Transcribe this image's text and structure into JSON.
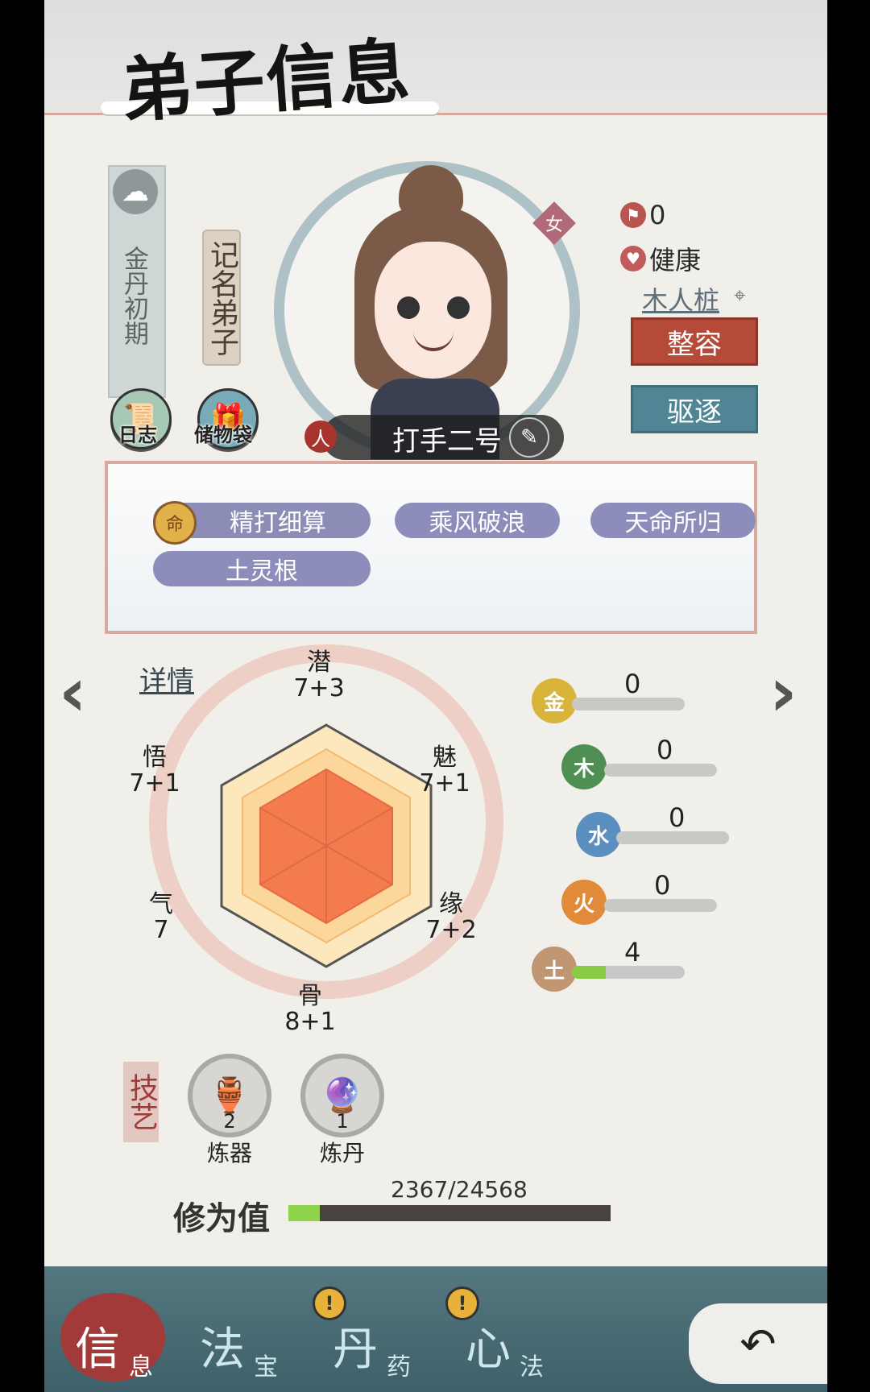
{
  "header": {
    "title": "弟子信息"
  },
  "rank": {
    "realm": "金丹初期",
    "title": "记名弟子"
  },
  "quick_icons": {
    "log_label": "日志",
    "bag_label": "储物袋"
  },
  "character": {
    "name": "打手二号",
    "gender": "女",
    "name_badge": "人",
    "mood_value": "0",
    "health": "健康",
    "location": "木人桩"
  },
  "actions": {
    "makeover": "整容",
    "expel": "驱逐"
  },
  "traits": [
    "精打细算",
    "乘风破浪",
    "天命所归",
    "土灵根"
  ],
  "trait_icon_char": "命",
  "radar": {
    "detail_link": "详情",
    "attributes": [
      {
        "name": "潜",
        "value": "7+3"
      },
      {
        "name": "魅",
        "value": "7+1"
      },
      {
        "name": "缘",
        "value": "7+2"
      },
      {
        "name": "骨",
        "value": "8+1"
      },
      {
        "name": "气",
        "value": "7"
      },
      {
        "name": "悟",
        "value": "7+1"
      }
    ]
  },
  "chart_data": {
    "type": "radar",
    "categories": [
      "潜",
      "魅",
      "缘",
      "骨",
      "气",
      "悟"
    ],
    "values": [
      "7+3",
      "7+1",
      "7+2",
      "8+1",
      "7",
      "7+1"
    ]
  },
  "elements": [
    {
      "name": "金",
      "value": "0",
      "fill": 0,
      "color": "#d8b53a"
    },
    {
      "name": "木",
      "value": "0",
      "fill": 0,
      "color": "#4f8f54"
    },
    {
      "name": "水",
      "value": "0",
      "fill": 0,
      "color": "#5b8fbf"
    },
    {
      "name": "火",
      "value": "0",
      "fill": 0,
      "color": "#e08a3a"
    },
    {
      "name": "土",
      "value": "4",
      "fill": 0.3,
      "color": "#c09572"
    }
  ],
  "skills": {
    "label": "技艺",
    "items": [
      {
        "name": "炼器",
        "count": "2",
        "icon": "furnace-icon"
      },
      {
        "name": "炼丹",
        "count": "1",
        "icon": "pill-icon"
      }
    ]
  },
  "cultivation": {
    "label": "修为值",
    "value": "2367/24568",
    "progress": 0.0963
  },
  "nav": {
    "tabs": [
      {
        "main": "信",
        "sub": "息",
        "badge": ""
      },
      {
        "main": "法",
        "sub": "宝",
        "badge": "!"
      },
      {
        "main": "丹",
        "sub": "药",
        "badge": "!"
      },
      {
        "main": "心",
        "sub": "法",
        "badge": ""
      }
    ],
    "back_icon": "back-arrow-icon"
  }
}
